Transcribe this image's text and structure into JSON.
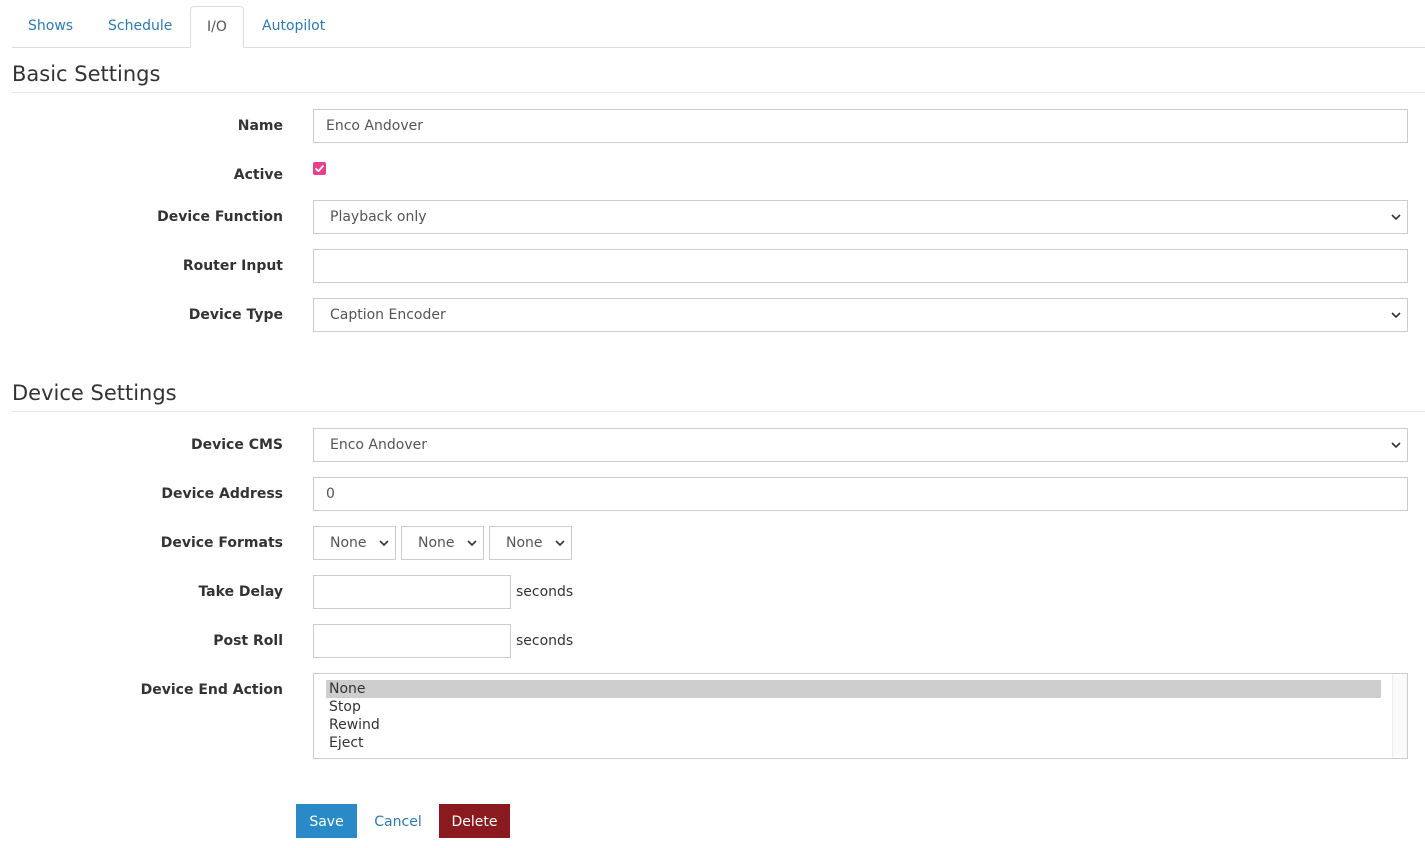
{
  "tabs": [
    {
      "label": "Shows"
    },
    {
      "label": "Schedule"
    },
    {
      "label": "I/O"
    },
    {
      "label": "Autopilot"
    }
  ],
  "basic": {
    "title": "Basic Settings",
    "name": {
      "label": "Name",
      "value": "Enco Andover"
    },
    "active": {
      "label": "Active",
      "checked": true
    },
    "device_function": {
      "label": "Device Function",
      "value": "Playback only"
    },
    "router_input": {
      "label": "Router Input",
      "value": ""
    },
    "device_type": {
      "label": "Device Type",
      "value": "Caption Encoder"
    }
  },
  "device": {
    "title": "Device Settings",
    "cms": {
      "label": "Device CMS",
      "value": "Enco Andover"
    },
    "address": {
      "label": "Device Address",
      "value": "0"
    },
    "formats": {
      "label": "Device Formats",
      "values": [
        "None",
        "None",
        "None"
      ]
    },
    "take_delay": {
      "label": "Take Delay",
      "value": "",
      "unit": "seconds"
    },
    "post_roll": {
      "label": "Post Roll",
      "value": "",
      "unit": "seconds"
    },
    "end_action": {
      "label": "Device End Action",
      "options": [
        "None",
        "Stop",
        "Rewind",
        "Eject"
      ],
      "selected": "None"
    }
  },
  "buttons": {
    "save": "Save",
    "cancel": "Cancel",
    "delete": "Delete"
  },
  "colors": {
    "link": "#2a7ab9",
    "save": "#2a8ac7",
    "delete": "#8b1a1f",
    "checkbox": "#e83e8c"
  }
}
